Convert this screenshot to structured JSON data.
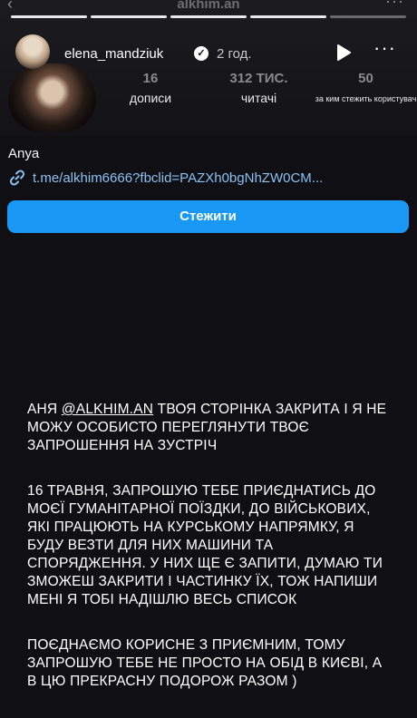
{
  "top_bar": {
    "title": "alkhim.an",
    "back_icon": "chevron-left-icon",
    "menu_icon": "more-horizontal-icon"
  },
  "story": {
    "progress": {
      "segments": 5,
      "active_segment": 4
    },
    "username": "elena_mandziuk",
    "verified": true,
    "time": "2 год.",
    "play_icon": "play-icon",
    "more_icon": "more-horizontal-icon",
    "text": {
      "p1_pre": "АНЯ ",
      "p1_mention": "@ALKHIM.AN",
      "p1_post": " ТВОЯ СТОРІНКА ЗАКРИТА І Я НЕ МОЖУ ОСОБИСТО ПЕРЕГЛЯНУТИ ТВОЄ ЗАПРОШЕННЯ НА ЗУСТРІЧ",
      "p2": "16 ТРАВНЯ, ЗАПРОШУЮ ТЕБЕ ПРИЄДНАТИСЬ ДО МОЄЇ ГУМАНІТАРНОЇ ПОЇЗДКИ, ДО ВІЙСЬКОВИХ, ЯКІ ПРАЦЮЮТЬ НА КУРСЬКОМУ НАПРЯМКУ, Я БУДУ ВЕЗТИ ДЛЯ НИХ МАШИНИ ТА СПОРЯДЖЕННЯ. У НИХ ЩЕ Є ЗАПИТИ, ДУМАЮ ТИ ЗМОЖЕШ ЗАКРИТИ І ЧАСТИНКУ ЇХ, ТОЖ НАПИШИ МЕНІ Я ТОБІ НАДІШЛЮ ВЕСЬ СПИСОК",
      "p3": "ПОЄДНАЄМО КОРИСНЕ З ПРИЄМНИМ, ТОМУ ЗАПРОШУЮ ТЕБЕ НЕ ПРОСТО НА ОБІД В КИЄВІ, А В ЦЮ ПРЕКРАСНУ ПОДОРОЖ РАЗОМ )"
    }
  },
  "profile": {
    "stats": [
      {
        "value": "16",
        "label": "дописи"
      },
      {
        "value": "312 ТИС.",
        "label": "читачі"
      },
      {
        "value": "50",
        "label": "за ким стежить користувач"
      }
    ],
    "name": "Anya",
    "link": "t.me/alkhim6666?fbclid=PAZXh0bgNhZW0CM...",
    "link_icon": "link-icon",
    "follow_label": "Стежити",
    "follow_color": "#1a98f5"
  }
}
